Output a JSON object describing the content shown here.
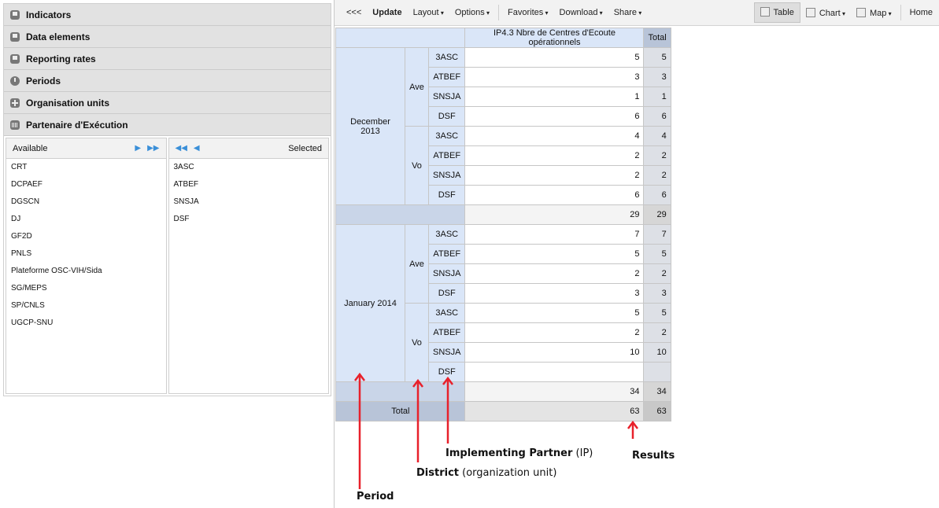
{
  "sidebar": {
    "items": [
      {
        "label": "Indicators",
        "icon": "doc"
      },
      {
        "label": "Data elements",
        "icon": "doc"
      },
      {
        "label": "Reporting rates",
        "icon": "doc"
      },
      {
        "label": "Periods",
        "icon": "clock"
      },
      {
        "label": "Organisation units",
        "icon": "plus"
      },
      {
        "label": "Partenaire d'Exécution",
        "icon": "grid"
      }
    ],
    "available_label": "Available",
    "selected_label": "Selected",
    "available": [
      "CRT",
      "DCPAEF",
      "DGSCN",
      "DJ",
      "GF2D",
      "PNLS",
      "Plateforme OSC-VIH/Sida",
      "SG/MEPS",
      "SP/CNLS",
      "UGCP-SNU"
    ],
    "selected": [
      "3ASC",
      "ATBEF",
      "SNSJA",
      "DSF"
    ]
  },
  "toolbar": {
    "collapse": "<<<",
    "update": "Update",
    "layout": "Layout",
    "options": "Options",
    "favorites": "Favorites",
    "download": "Download",
    "share": "Share",
    "table": "Table",
    "chart": "Chart",
    "map": "Map",
    "home": "Home"
  },
  "table": {
    "column_header": "IP4.3 Nbre de Centres d'Ecoute opérationnels",
    "total_header": "Total",
    "total_label": "Total",
    "periods": [
      {
        "name": "December 2013",
        "subtotal": "29",
        "districts": [
          {
            "name": "Ave",
            "rows": [
              [
                "3ASC",
                "5"
              ],
              [
                "ATBEF",
                "3"
              ],
              [
                "SNSJA",
                "1"
              ],
              [
                "DSF",
                "6"
              ]
            ]
          },
          {
            "name": "Vo",
            "rows": [
              [
                "3ASC",
                "4"
              ],
              [
                "ATBEF",
                "2"
              ],
              [
                "SNSJA",
                "2"
              ],
              [
                "DSF",
                "6"
              ]
            ]
          }
        ]
      },
      {
        "name": "January 2014",
        "subtotal": "34",
        "districts": [
          {
            "name": "Ave",
            "rows": [
              [
                "3ASC",
                "7"
              ],
              [
                "ATBEF",
                "5"
              ],
              [
                "SNSJA",
                "2"
              ],
              [
                "DSF",
                "3"
              ]
            ]
          },
          {
            "name": "Vo",
            "rows": [
              [
                "3ASC",
                "5"
              ],
              [
                "ATBEF",
                "2"
              ],
              [
                "SNSJA",
                "10"
              ],
              [
                "DSF",
                ""
              ]
            ]
          }
        ]
      }
    ],
    "grand_total": "63"
  },
  "annotations": {
    "period": "Period",
    "district": "District",
    "district_note": "(organization unit)",
    "ip": "Implementing Partner",
    "ip_note": "(IP)",
    "results": "Results",
    "arrow_color": "#e8212b"
  }
}
